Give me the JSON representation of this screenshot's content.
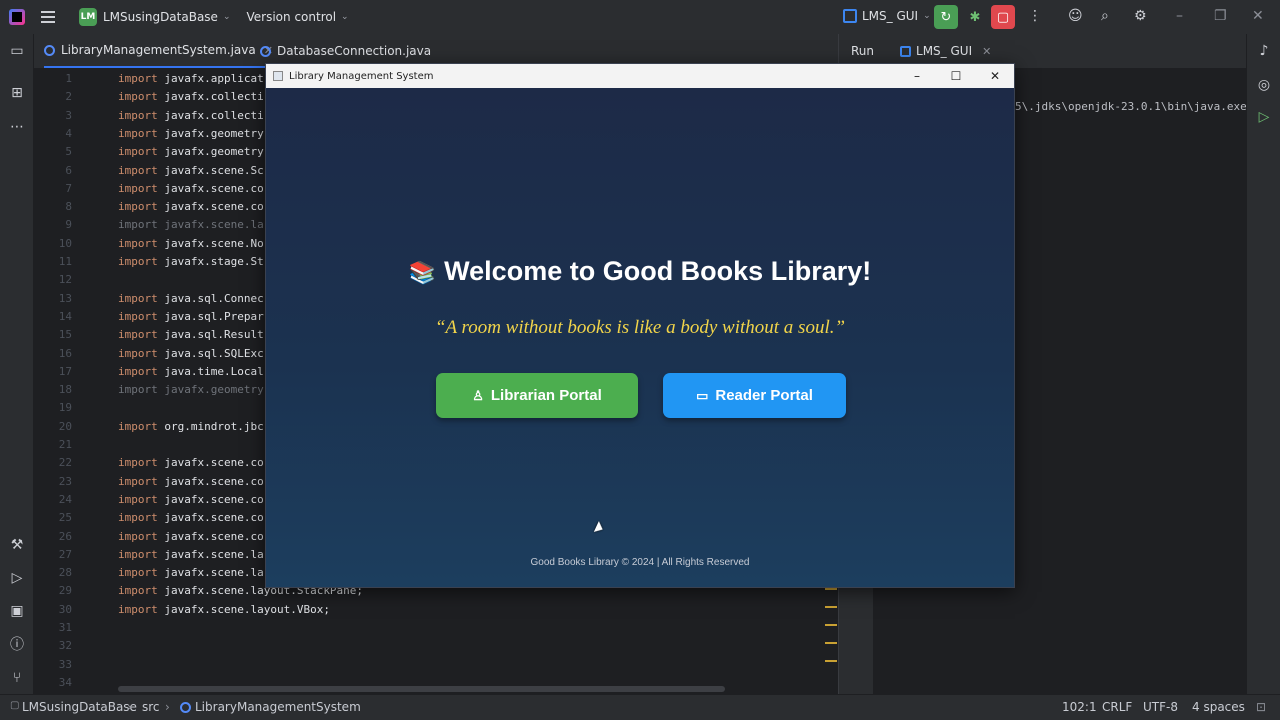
{
  "ide": {
    "project_badge": "LM",
    "project_name": "LMSusingDataBase",
    "vcs_label": "Version control",
    "run_config": "LMS_ GUI",
    "tabs": [
      {
        "label": "LibraryManagementSystem.java"
      },
      {
        "label": "DatabaseConnection.java"
      }
    ],
    "run_panel": {
      "title": "Run",
      "tab": "LMS_ GUI",
      "console_line": "5\\.jdks\\openjdk-23.0.1\\bin\\java.exe"
    },
    "colors": {
      "accent": "#3574f0",
      "keyword": "#cf8e6d",
      "run_green": "#4a9e55",
      "stop_red": "#e0484e"
    }
  },
  "code": {
    "lines": [
      {
        "n": "1",
        "kw": "import",
        "rest": " javafx.applicat",
        "dim": false
      },
      {
        "n": "2",
        "kw": "import",
        "rest": " javafx.collecti",
        "dim": false
      },
      {
        "n": "3",
        "kw": "import",
        "rest": " javafx.collecti",
        "dim": false
      },
      {
        "n": "4",
        "kw": "import",
        "rest": " javafx.geometry",
        "dim": false
      },
      {
        "n": "5",
        "kw": "import",
        "rest": " javafx.geometry",
        "dim": false
      },
      {
        "n": "6",
        "kw": "import",
        "rest": " javafx.scene.Sc",
        "dim": false
      },
      {
        "n": "7",
        "kw": "import",
        "rest": " javafx.scene.co",
        "dim": false
      },
      {
        "n": "8",
        "kw": "import",
        "rest": " javafx.scene.co",
        "dim": false
      },
      {
        "n": "9",
        "kw": "import",
        "rest": " javafx.scene.la",
        "dim": true
      },
      {
        "n": "10",
        "kw": "import",
        "rest": " javafx.scene.No",
        "dim": false
      },
      {
        "n": "11",
        "kw": "import",
        "rest": " javafx.stage.St",
        "dim": false
      },
      {
        "n": "12",
        "kw": "",
        "rest": "",
        "dim": false
      },
      {
        "n": "13",
        "kw": "import",
        "rest": " java.sql.Connec",
        "dim": false
      },
      {
        "n": "14",
        "kw": "import",
        "rest": " java.sql.Prepar",
        "dim": false
      },
      {
        "n": "15",
        "kw": "import",
        "rest": " java.sql.Result",
        "dim": false
      },
      {
        "n": "16",
        "kw": "import",
        "rest": " java.sql.SQLExc",
        "dim": false
      },
      {
        "n": "17",
        "kw": "import",
        "rest": " java.time.Local",
        "dim": false
      },
      {
        "n": "18",
        "kw": "import",
        "rest": " javafx.geometry",
        "dim": true
      },
      {
        "n": "19",
        "kw": "",
        "rest": "",
        "dim": false
      },
      {
        "n": "20",
        "kw": "import",
        "rest": " org.mindrot.jbc",
        "dim": false
      },
      {
        "n": "21",
        "kw": "",
        "rest": "",
        "dim": false
      },
      {
        "n": "22",
        "kw": "import",
        "rest": " javafx.scene.co",
        "dim": false
      },
      {
        "n": "23",
        "kw": "import",
        "rest": " javafx.scene.co",
        "dim": false
      },
      {
        "n": "24",
        "kw": "import",
        "rest": " javafx.scene.co",
        "dim": false
      },
      {
        "n": "25",
        "kw": "import",
        "rest": " javafx.scene.co",
        "dim": false
      },
      {
        "n": "26",
        "kw": "import",
        "rest": " javafx.scene.co",
        "dim": false
      },
      {
        "n": "27",
        "kw": "import",
        "rest": " javafx.scene.la",
        "dim": false
      },
      {
        "n": "28",
        "kw": "import",
        "rest": " javafx.scene.la",
        "dim": false
      },
      {
        "n": "29",
        "kw": "import",
        "rest": " javafx.scene.layout.StackPane;",
        "dim": false
      },
      {
        "n": "30",
        "kw": "import",
        "rest": " javafx.scene.layout.VBox;",
        "dim": false
      },
      {
        "n": "31",
        "kw": "",
        "rest": "",
        "dim": false
      },
      {
        "n": "32",
        "kw": "",
        "rest": "",
        "dim": false
      },
      {
        "n": "33",
        "kw": "",
        "rest": "",
        "dim": false
      },
      {
        "n": "34",
        "kw": "",
        "rest": "",
        "dim": false
      }
    ]
  },
  "status": {
    "project": "LMSusingDataBase",
    "src": "src",
    "file": "LibraryManagementSystem",
    "position": "102:1",
    "line_sep": "CRLF",
    "encoding": "UTF-8",
    "indent": "4 spaces"
  },
  "app": {
    "window_title": "Library Management System",
    "welcome": "Welcome to Good Books Library!",
    "welcome_icon": "books-emoji",
    "quote": "“A room without books is like a body without a soul.”",
    "librarian_button": "Librarian Portal",
    "reader_button": "Reader Portal",
    "footer": "Good Books Library © 2024 | All Rights Reserved",
    "colors": {
      "librarian": "#4cae4f",
      "reader": "#2196f3",
      "quote": "#f1d44a",
      "bg_top": "#1d2a47",
      "bg_bottom": "#1c3e5e"
    }
  }
}
